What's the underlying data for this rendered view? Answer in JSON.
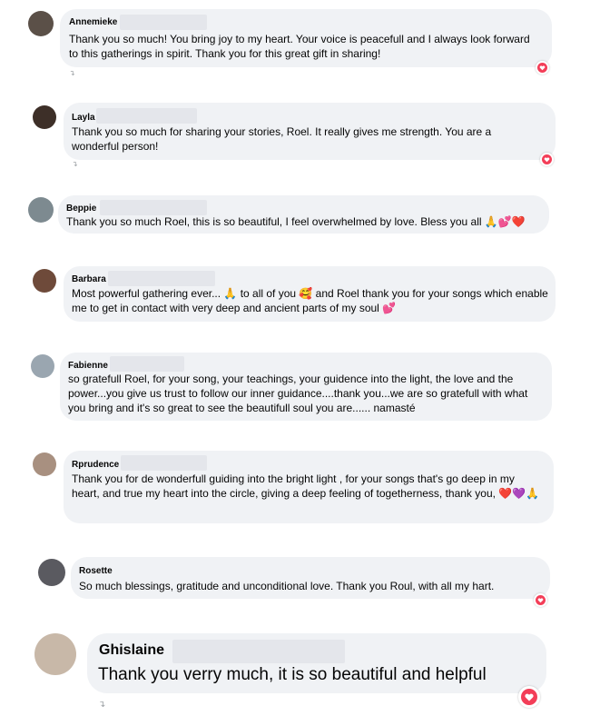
{
  "comments": [
    {
      "name": "Annemieke",
      "text": "Thank you so much! You bring joy to my heart. Your voice is peacefull and I always look forward to this gatherings in spirit. Thank you for this great gift in sharing!"
    },
    {
      "name": "Layla",
      "text": "Thank you so much for sharing your stories, Roel. It really gives me strength. You are a wonderful person!"
    },
    {
      "name": "Beppie",
      "text": "Thank you so much Roel, this is so beautiful, I feel overwhelmed by love. Bless you all 🙏💕❤️"
    },
    {
      "name": "Barbara",
      "text": "Most powerful gathering ever... 🙏 to all of you 🥰 and Roel thank you for your songs which enable me to get in contact with very deep and ancient parts of my soul 💕"
    },
    {
      "name": "Fabienne",
      "text": "so gratefull Roel, for your song, your teachings, your guidence into the light, the love and the power...you give us trust to follow our inner guidance....thank you...we are so gratefull with what you bring and it's so great to see the beautifull soul you are...... namasté"
    },
    {
      "name": "Rprudence",
      "text": "Thank you for de wonderfull guiding into the bright light , for your songs that's go deep in my heart, and true my heart into the circle, giving a deep feeling of togetherness, thank you, ❤️💜🙏"
    },
    {
      "name": "Rosette",
      "text": "So much blessings, gratitude and unconditional love. Thank you Roul, with all my hart."
    },
    {
      "name": "Ghislaine",
      "text": "Thank you verry much, it is so beautiful and helpful"
    }
  ],
  "icons": {
    "reaction": "love-reaction-icon",
    "avatar": "profile-photo"
  },
  "colors": {
    "bubble": "#f0f2f5",
    "love": "#f33e58",
    "redaction": "#e4e6eb"
  }
}
